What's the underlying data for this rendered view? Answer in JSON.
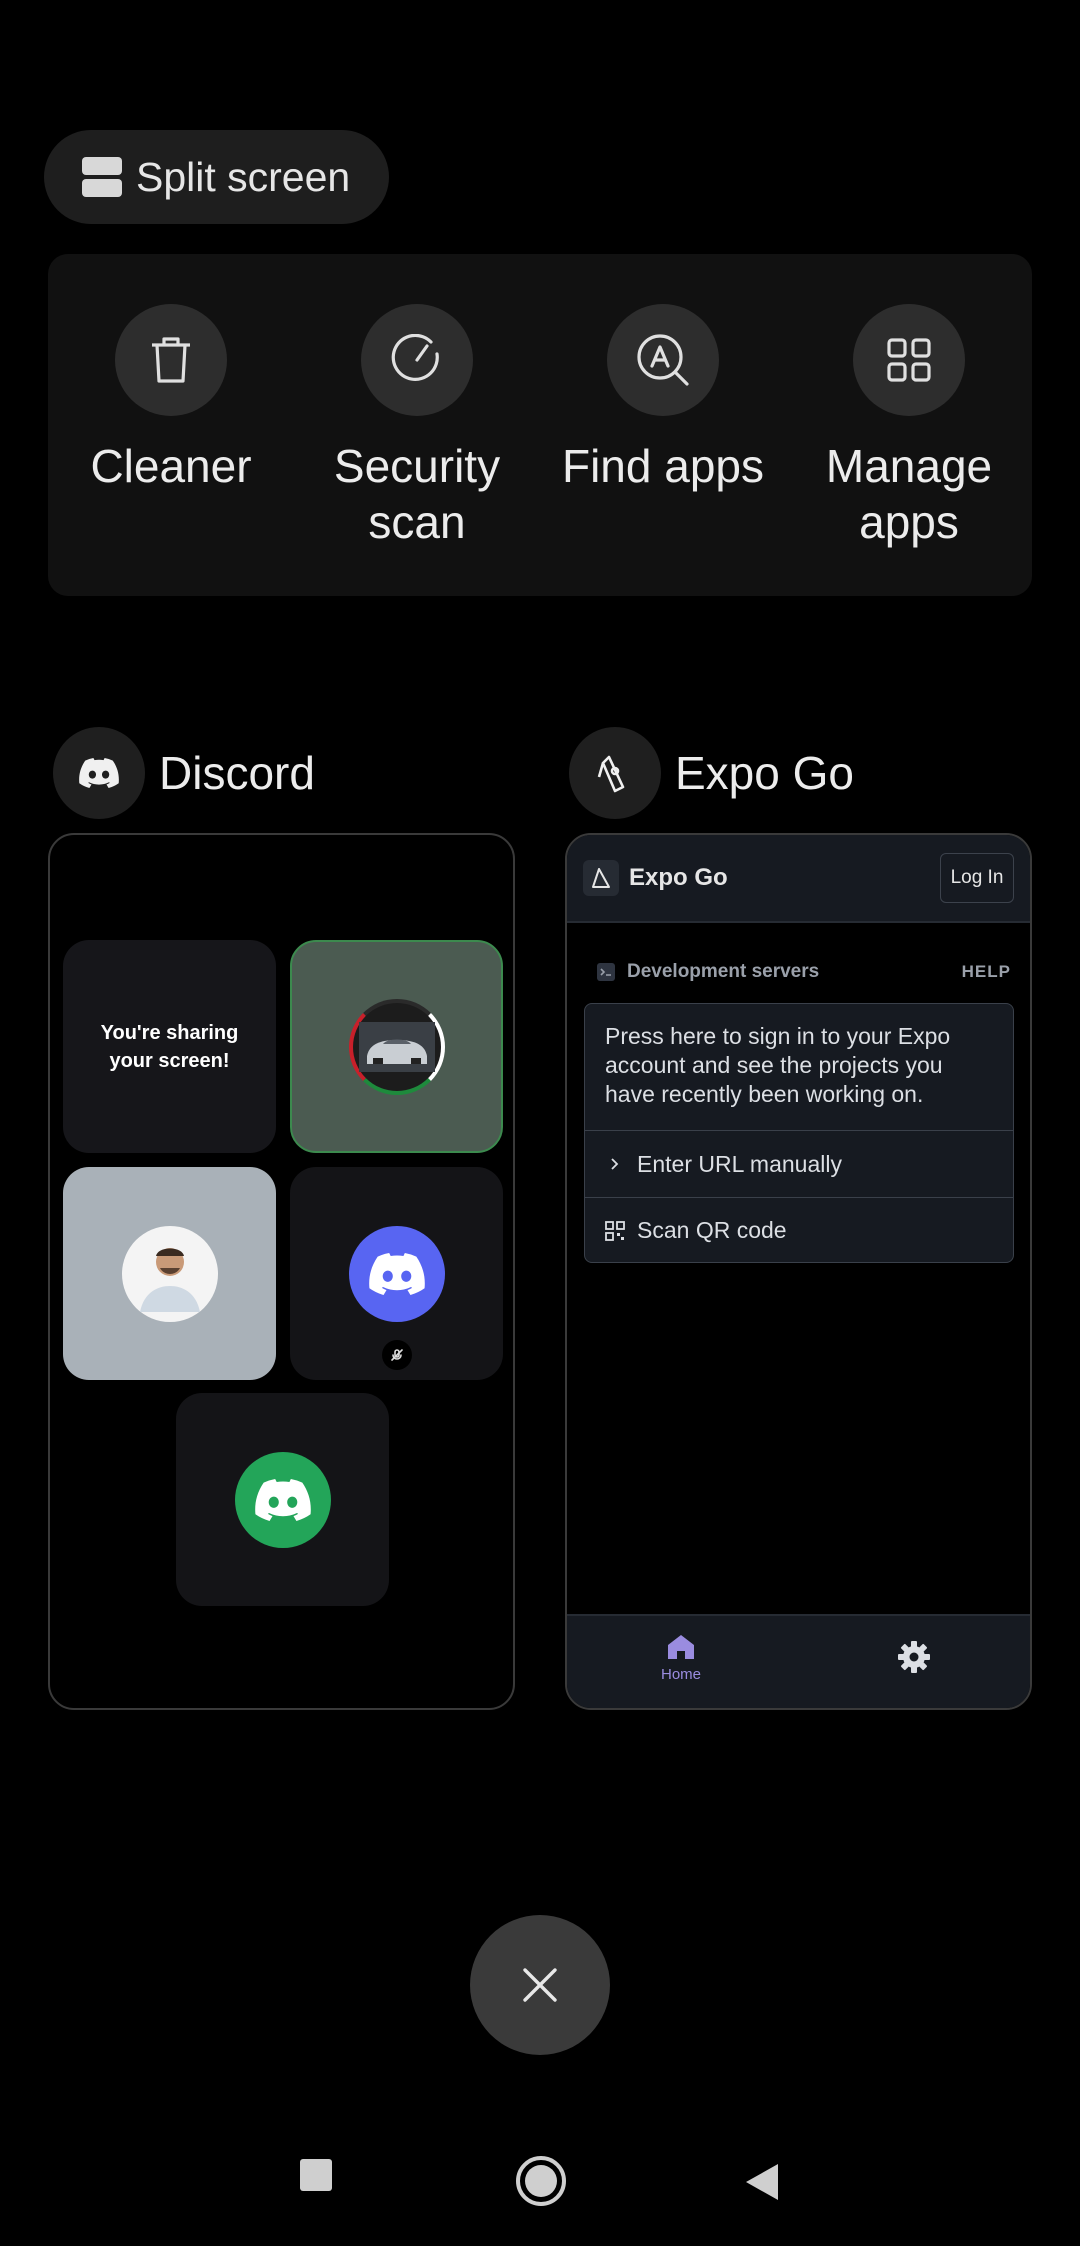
{
  "split_screen": {
    "label": "Split screen"
  },
  "tools": [
    {
      "label": "Cleaner",
      "icon": "trash-icon"
    },
    {
      "label": "Security\nscan",
      "icon": "security-scan-icon"
    },
    {
      "label": "Find apps",
      "icon": "find-apps-icon"
    },
    {
      "label": "Manage\napps",
      "icon": "grid-icon"
    }
  ],
  "apps": {
    "discord": {
      "name": "Discord",
      "sharing_text_1": "You're sharing",
      "sharing_text_2": "your screen!",
      "colors": {
        "blurple": "#5865F2",
        "green": "#23A559"
      }
    },
    "expo": {
      "name": "Expo Go",
      "header_title": "Expo Go",
      "login_label": "Log In",
      "dev_servers_label": "Development servers",
      "help_label": "HELP",
      "sign_in_text": "Press here to sign in to your Expo account and see the projects you have recently been working on.",
      "enter_url_label": "Enter URL manually",
      "scan_qr_label": "Scan QR code",
      "home_tab_label": "Home",
      "accent": "#9A8CE0"
    }
  }
}
